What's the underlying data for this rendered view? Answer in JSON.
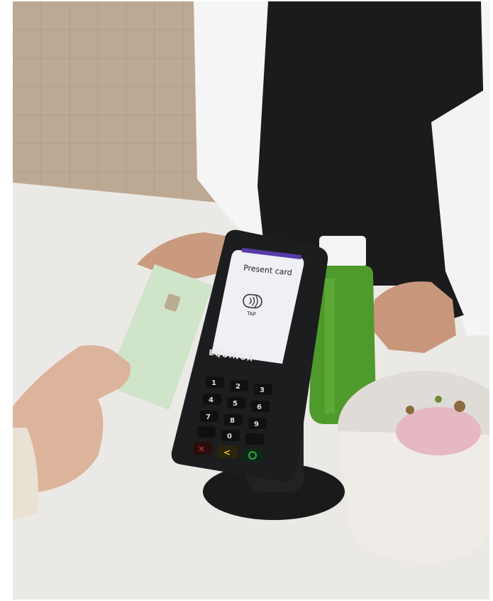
{
  "terminal": {
    "screen_title": "Present card",
    "tap_label": "TAP",
    "brand": "EQUINOX",
    "keypad": {
      "keys": [
        "1",
        "2",
        "3",
        "4",
        "5",
        "6",
        "7",
        "8",
        "9",
        "0"
      ],
      "action_keys": [
        "cancel",
        "correct",
        "enter"
      ]
    }
  },
  "colors": {
    "wall": "#bfa993",
    "counter": "#ebe9e6",
    "terminal_body": "#1b1c1e",
    "screen_bg": "#eef0f4",
    "card": "#cfe4c8",
    "juice": "#4f9a2c",
    "apron": "#1a1a1a",
    "cancel_key": "#d2322b",
    "correct_key": "#e6c21c",
    "enter_key": "#2fa64a"
  },
  "icons": [
    "contactless-icon",
    "emv-chip-icon"
  ]
}
